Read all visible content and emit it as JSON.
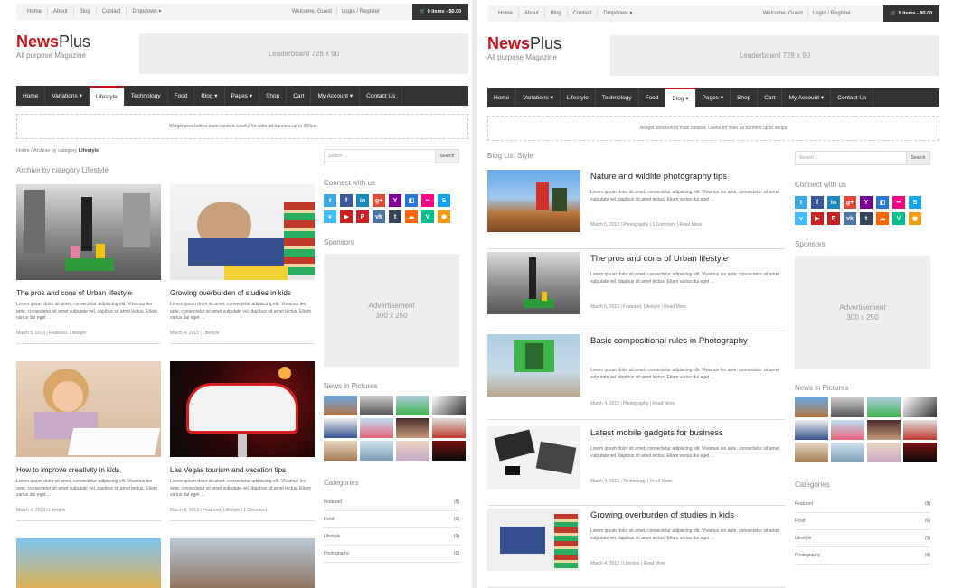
{
  "topbar": {
    "links": [
      "Home",
      "About",
      "Blog",
      "Contact",
      "Dropdown ▾"
    ],
    "welcome": "Welcome, Guest",
    "login": "Login / Register",
    "cart": "0 items - $0.00"
  },
  "brand": {
    "name_bold": "News",
    "name_rest": "Plus",
    "tagline": "All purpose Magazine"
  },
  "leaderboard": "Leaderboard 728 x 90",
  "widget_area": "Widget area before main content. Useful for wide ad banners up to 980px",
  "left": {
    "nav": [
      "Home",
      "Variations ▾",
      "Lifestyle",
      "Technology",
      "Food",
      "Blog ▾",
      "Pages ▾",
      "Shop",
      "Cart",
      "My Account ▾",
      "Contact Us"
    ],
    "active_nav": 2,
    "breadcrumb": {
      "home": "Home",
      "sep": " / Archive by category ",
      "current": "Lifestyle"
    },
    "heading": "Archive by category Lifestyle",
    "cards": [
      {
        "title": "The pros and cons of Urban lifestyle",
        "excerpt": "Lorem ipsum dolor sit amet, consectetur adipiscing elit. Vivamus leo ante, consectetur sit amet vulputate vel, dapibus sit amet lectus. Etiam varius dui eget …",
        "meta": "March 5, 2013  |  Featured, Lifestyle"
      },
      {
        "title": "Growing overburden of studies in kids",
        "excerpt": "Lorem ipsum dolor sit amet, consectetur adipiscing elit. Vivamus leo ante, consectetur sit amet vulputate vel, dapibus sit amet lectus. Etiam varius dui eget …",
        "meta": "March 4, 2013  |  Lifestyle"
      },
      {
        "title": "How to improve creativity in kids",
        "excerpt": "Lorem ipsum dolor sit amet, consectetur adipiscing elit. Vivamus leo ante, consectetur sit amet vulputate vel, dapibus sit amet lectus. Etiam varius dui eget …",
        "meta": "March 4, 2013  |  Lifestyle"
      },
      {
        "title": "Las Vegas tourism and vacation tips",
        "excerpt": "Lorem ipsum dolor sit amet, consectetur adipiscing elit. Vivamus leo ante, consectetur sit amet vulputate vel, dapibus sit amet lectus. Etiam varius dui eget …",
        "meta": "March 4, 2013  |  Featured, Lifestyle  |  1 Comment"
      }
    ]
  },
  "right": {
    "nav": [
      "Home",
      "Variations ▾",
      "Lifestyle",
      "Technology",
      "Food",
      "Blog ▾",
      "Pages ▾",
      "Shop",
      "Cart",
      "My Account ▾",
      "Contact Us"
    ],
    "active_nav": 5,
    "heading": "Blog List Style",
    "posts": [
      {
        "title": "Nature and wildlife photography tips",
        "excerpt": "Lorem ipsum dolor sit amet, consectetur adipiscing elit. Vivamus leo ante, consectetur sit amet vulputate vel, dapibus sit amet lectus. Etiam varius dui eget …",
        "meta": "March 5, 2013  |  Photography  |  1 Comment  |  Read More"
      },
      {
        "title": "The pros and cons of Urban lifestyle",
        "excerpt": "Lorem ipsum dolor sit amet, consectetur adipiscing elit. Vivamus leo ante, consectetur sit amet vulputate vel, dapibus sit amet lectus. Etiam varius dui eget …",
        "meta": "March 5, 2013  |  Featured, Lifestyle  |  Read More"
      },
      {
        "title": "Basic compositional rules in Photography",
        "excerpt": "Lorem ipsum dolor sit amet, consectetur adipiscing elit. Vivamus leo ante, consectetur sit amet vulputate vel, dapibus sit amet lectus. Etiam varius dui eget …",
        "meta": "March 4, 2013  |  Photography  |  Read More"
      },
      {
        "title": "Latest mobile gadgets for business",
        "excerpt": "Lorem ipsum dolor sit amet, consectetur adipiscing elit. Vivamus leo ante, consectetur sit amet vulputate vel, dapibus sit amet lectus. Etiam varius dui eget …",
        "meta": "March 4, 2013  |  Technology  |  Read More"
      },
      {
        "title": "Growing overburden of studies in kids",
        "excerpt": "Lorem ipsum dolor sit amet, consectetur adipiscing elit. Vivamus leo ante, consectetur sit amet vulputate vel, dapibus sit amet lectus. Etiam varius dui eget …",
        "meta": "March 4, 2013  |  Lifestyle  |  Read More"
      }
    ]
  },
  "sidebar": {
    "search_placeholder": "Search ...",
    "search_button": "Search",
    "connect_heading": "Connect with us",
    "socials": [
      {
        "icon": "twitter-icon",
        "glyph": "t",
        "color": "#3aa9e0"
      },
      {
        "icon": "facebook-icon",
        "glyph": "f",
        "color": "#3b5998"
      },
      {
        "icon": "linkedin-icon",
        "glyph": "in",
        "color": "#1c87bd"
      },
      {
        "icon": "googleplus-icon",
        "glyph": "g+",
        "color": "#dd4b39"
      },
      {
        "icon": "yahoo-icon",
        "glyph": "Y",
        "color": "#7b0099"
      },
      {
        "icon": "delicious-icon",
        "glyph": "◧",
        "color": "#2a75d6"
      },
      {
        "icon": "flickr-icon",
        "glyph": "••",
        "color": "#ff0084"
      },
      {
        "icon": "skype-icon",
        "glyph": "S",
        "color": "#12a5f4"
      },
      {
        "icon": "vimeo-icon",
        "glyph": "v",
        "color": "#44bbff"
      },
      {
        "icon": "youtube-icon",
        "glyph": "▶",
        "color": "#cc2020"
      },
      {
        "icon": "pinterest-icon",
        "glyph": "P",
        "color": "#cb2027"
      },
      {
        "icon": "vk-icon",
        "glyph": "vk",
        "color": "#4c75a3"
      },
      {
        "icon": "tumblr-icon",
        "glyph": "t",
        "color": "#35465c"
      },
      {
        "icon": "soundcloud-icon",
        "glyph": "☁",
        "color": "#ff6600"
      },
      {
        "icon": "vine-icon",
        "glyph": "V",
        "color": "#00bf8f"
      },
      {
        "icon": "rss-icon",
        "glyph": "◉",
        "color": "#f39c12"
      }
    ],
    "sponsors_heading": "Sponsors",
    "ad_line1": "Advertisement",
    "ad_line2": "300 x 250",
    "pictures_heading": "News in Pictures",
    "categories_heading": "Categories",
    "categories": [
      {
        "name": "Featured",
        "count": "(8)"
      },
      {
        "name": "Food",
        "count": "(6)"
      },
      {
        "name": "Lifestyle",
        "count": "(9)"
      },
      {
        "name": "Photography",
        "count": "(6)"
      }
    ]
  },
  "colors": {
    "brand_red": "#c3151a",
    "nav_bg": "#333333"
  }
}
